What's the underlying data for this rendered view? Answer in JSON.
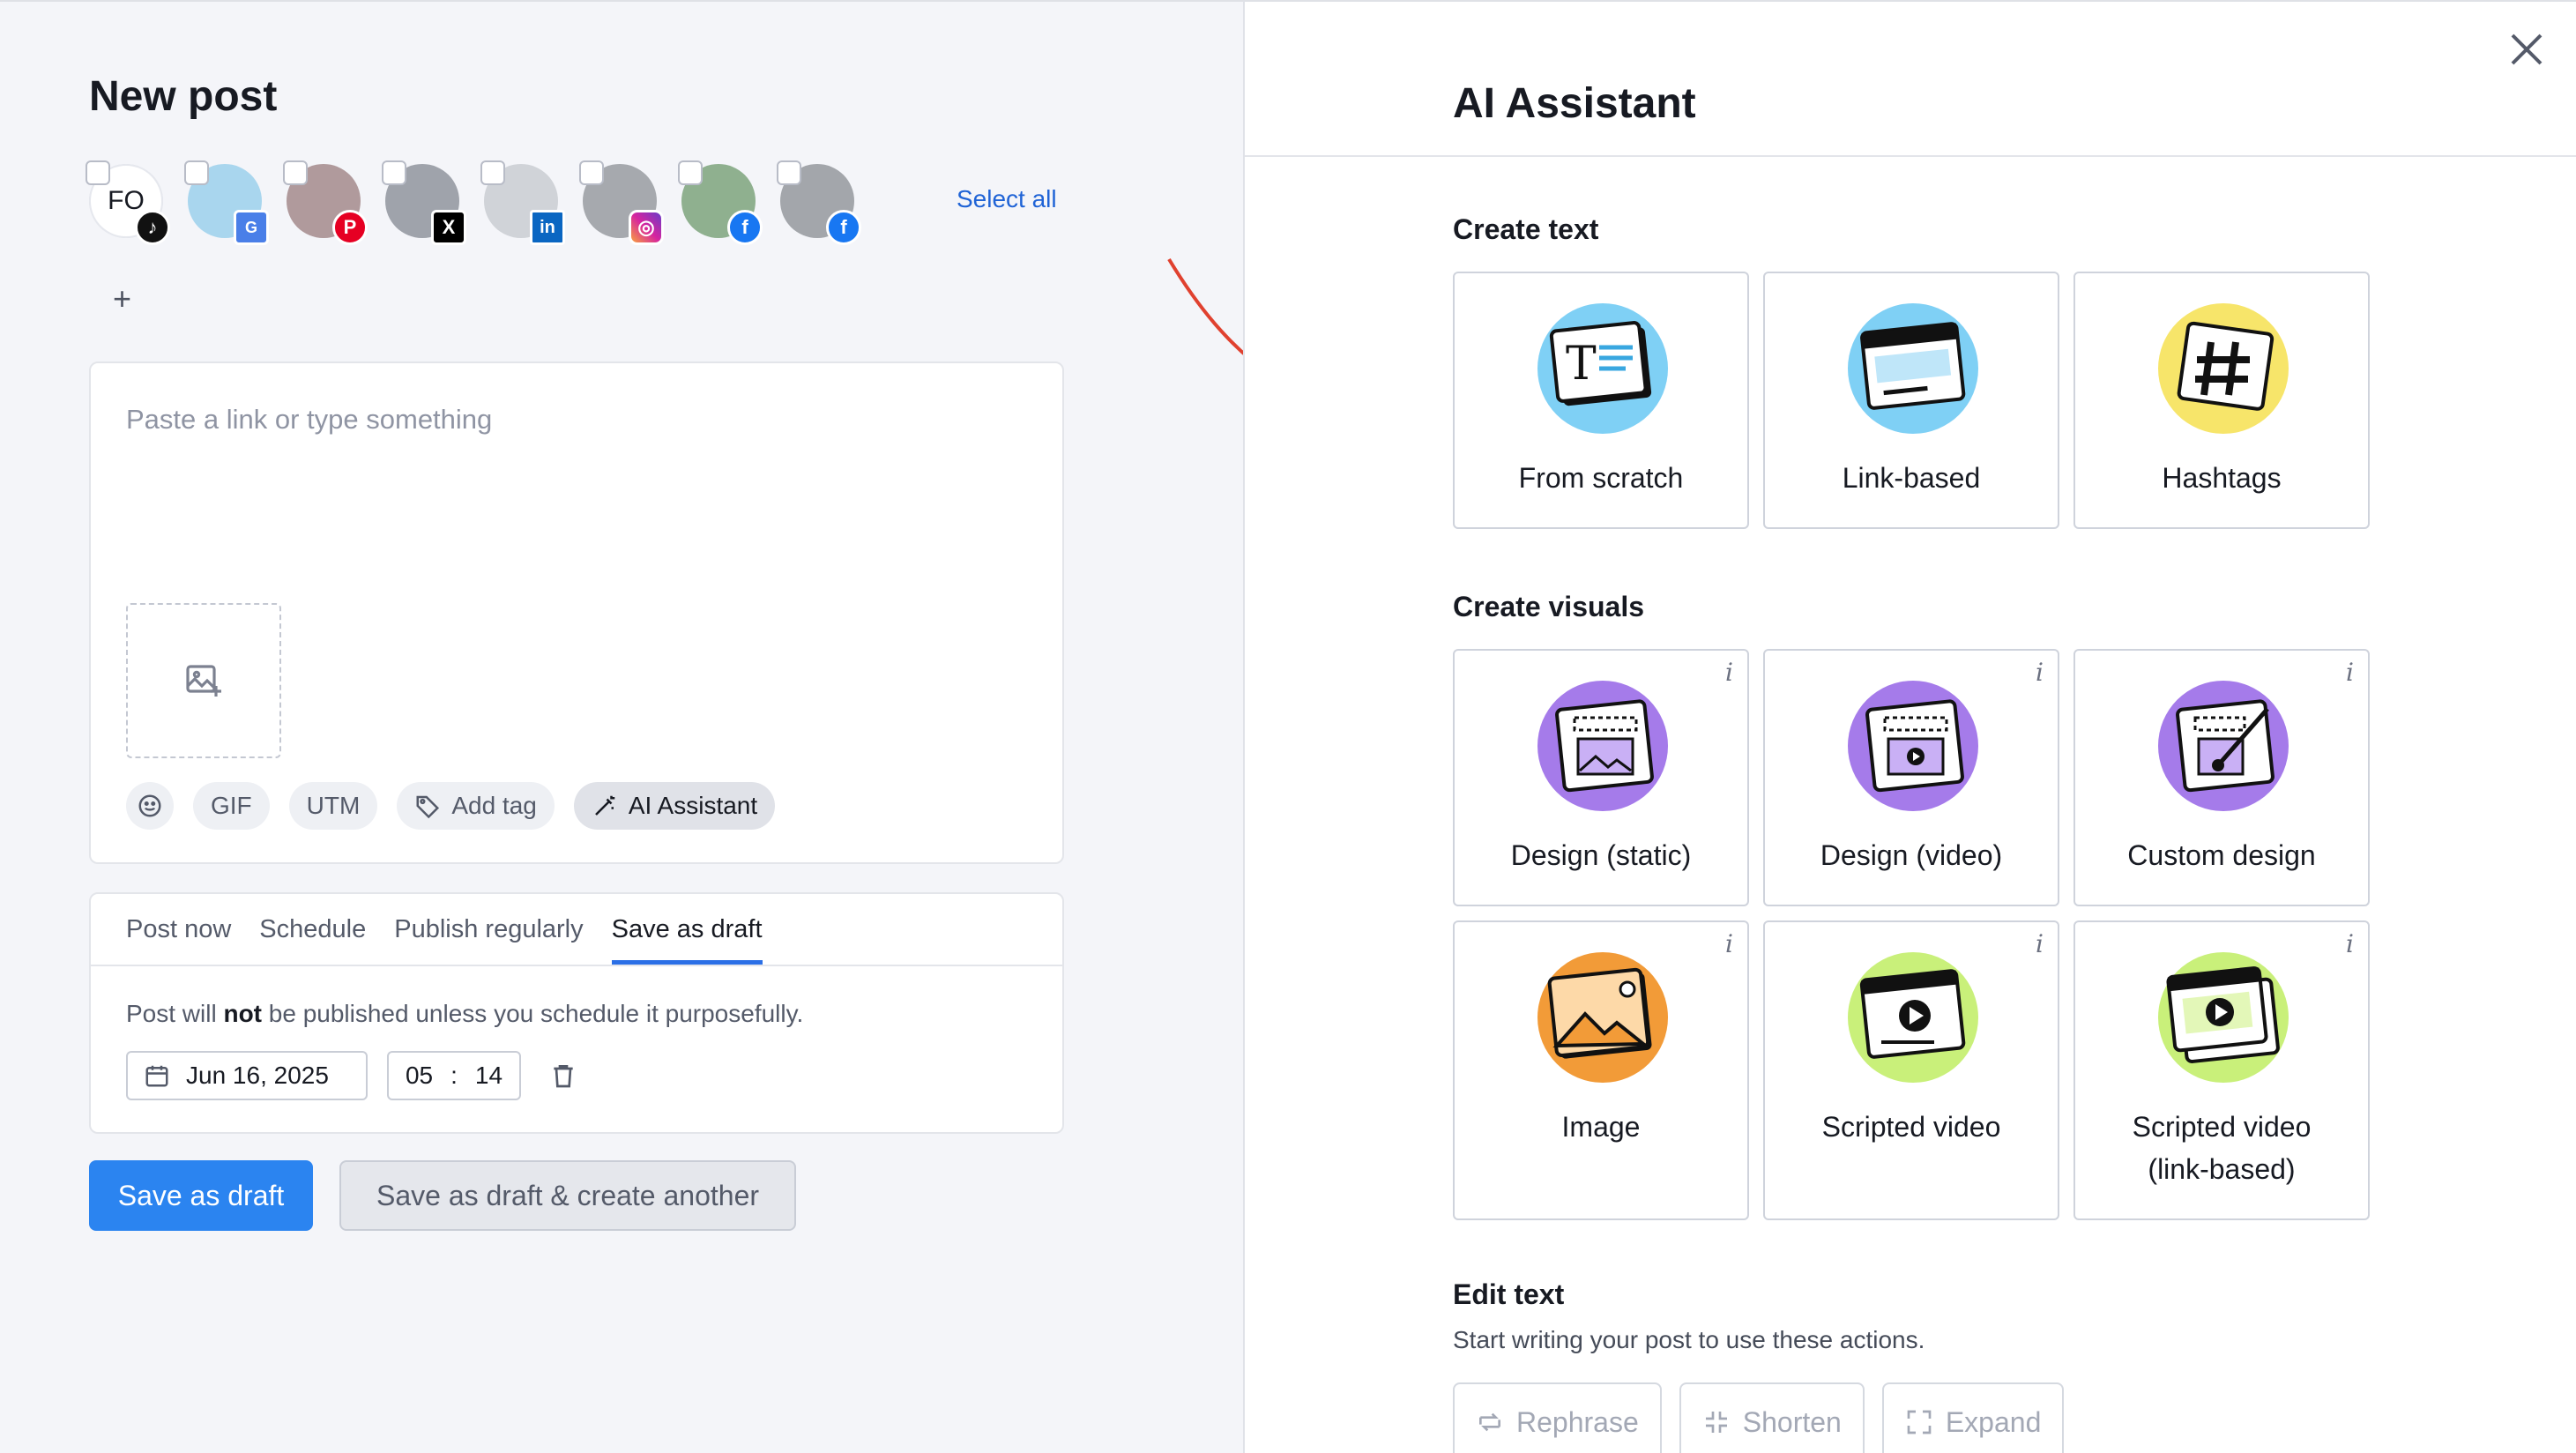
{
  "left": {
    "title": "New post",
    "select_all": "Select all",
    "add_account": "+",
    "accounts": [
      {
        "initials": "FO",
        "network": "tiktok"
      },
      {
        "initials": "",
        "network": "google-business"
      },
      {
        "initials": "",
        "network": "pinterest"
      },
      {
        "initials": "",
        "network": "x"
      },
      {
        "initials": "",
        "network": "linkedin"
      },
      {
        "initials": "",
        "network": "instagram"
      },
      {
        "initials": "",
        "network": "facebook"
      },
      {
        "initials": "",
        "network": "facebook"
      }
    ],
    "composer": {
      "placeholder": "Paste a link or type something",
      "tools": {
        "gif": "GIF",
        "utm": "UTM",
        "add_tag": "Add tag",
        "ai_assistant": "AI Assistant"
      }
    },
    "publish": {
      "tabs": [
        "Post now",
        "Schedule",
        "Publish regularly",
        "Save as draft"
      ],
      "active_tab": 3,
      "note_prefix": "Post will ",
      "note_bold": "not",
      "note_suffix": " be published unless you schedule it purposefully.",
      "date": "Jun 16, 2025",
      "hour": "05",
      "sep": ":",
      "minute": "14"
    },
    "buttons": {
      "save_draft": "Save as draft",
      "save_draft_another": "Save as draft & create another"
    }
  },
  "panel": {
    "title": "AI Assistant",
    "create_text": {
      "heading": "Create text",
      "items": [
        "From scratch",
        "Link-based",
        "Hashtags"
      ]
    },
    "create_visuals": {
      "heading": "Create visuals",
      "items": [
        "Design (static)",
        "Design (video)",
        "Custom design",
        "Image",
        "Scripted video",
        "Scripted video",
        "(link-based)"
      ]
    },
    "info_glyph": "i",
    "edit_text": {
      "heading": "Edit text",
      "subtitle": "Start writing your post to use these actions.",
      "actions": [
        "Rephrase",
        "Shorten",
        "Expand"
      ]
    }
  },
  "colors": {
    "accent": "#2b84f0",
    "link": "#1f63d6",
    "arrow": "#e0412f",
    "blue_blob": "#7fd0f5",
    "yellow_blob": "#f7e56a",
    "purple_blob": "#a57bea",
    "orange_blob": "#f29b38",
    "green_blob": "#c9f07a"
  }
}
